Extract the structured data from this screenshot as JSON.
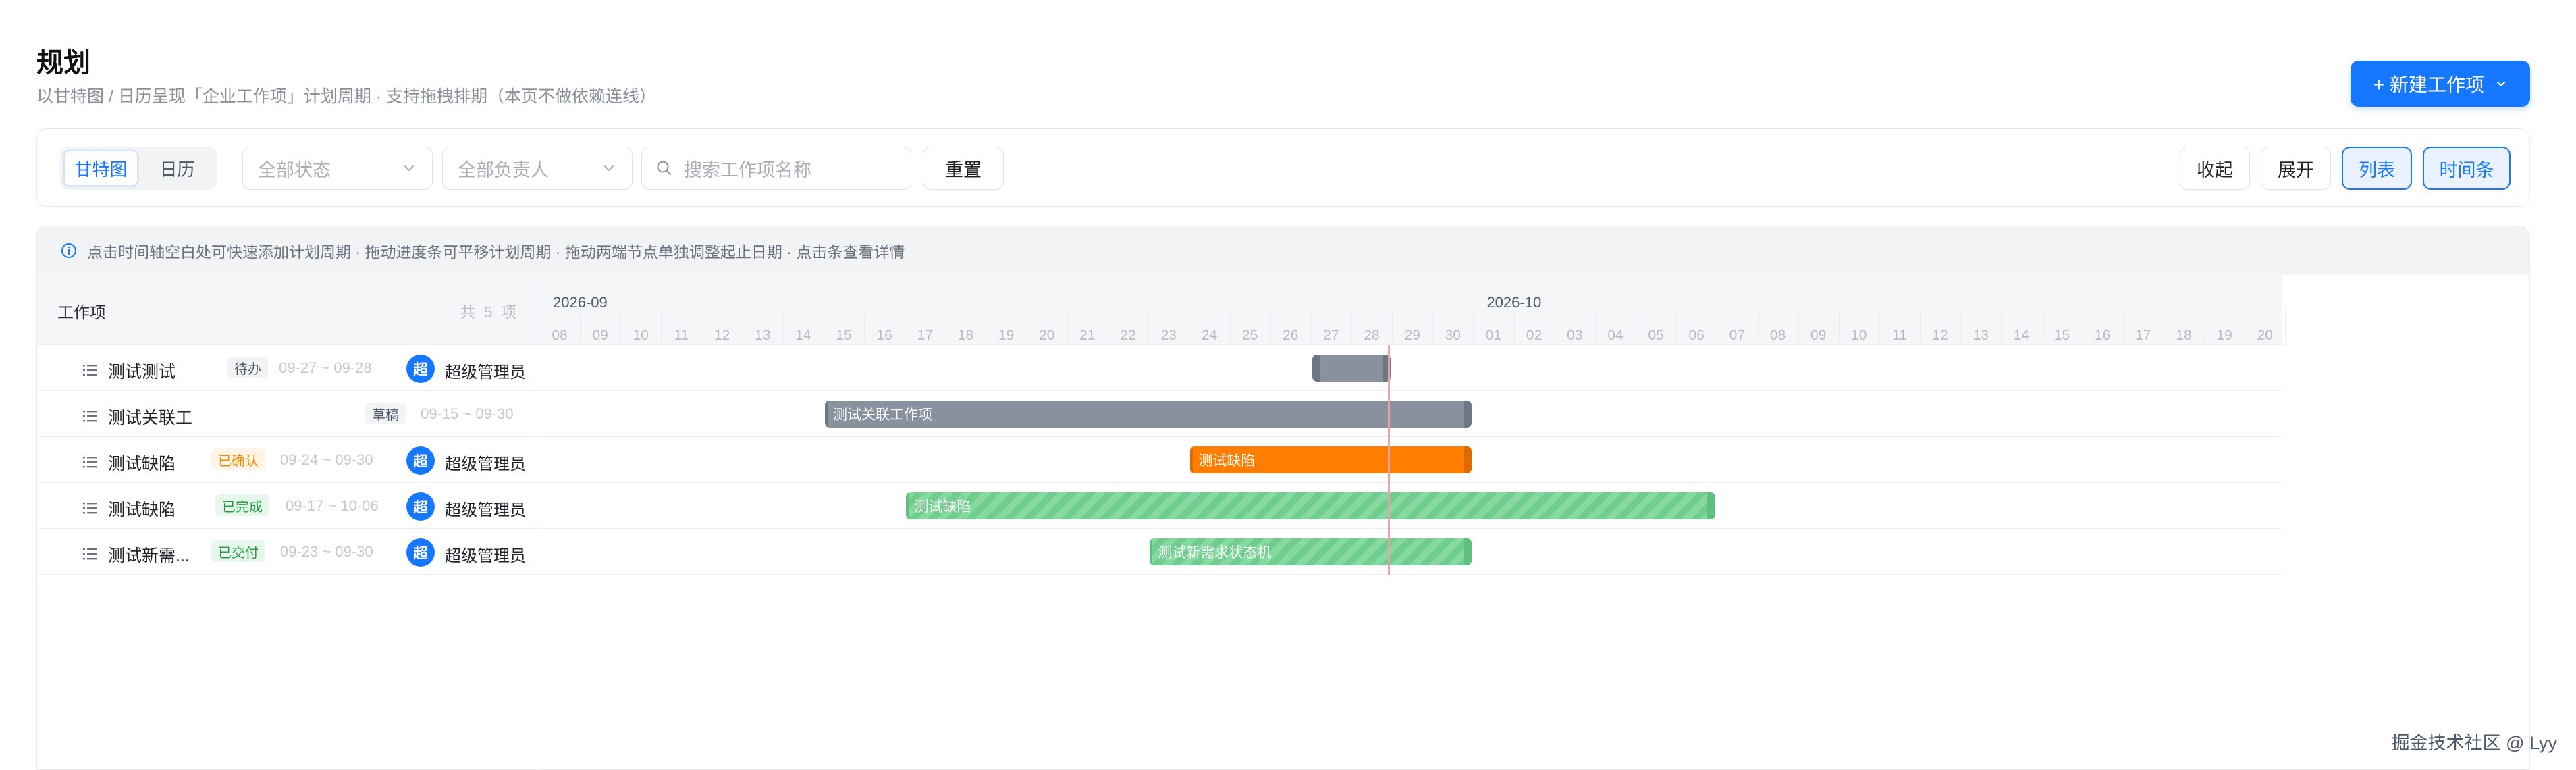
{
  "header": {
    "title": "规划",
    "subtitle": "以甘特图 / 日历呈现「企业工作项」计划周期 · 支持拖拽排期（本页不做依赖连线）",
    "new_button": "+ 新建工作项"
  },
  "toolbar": {
    "views": [
      "甘特图",
      "日历"
    ],
    "active_view": "甘特图",
    "status_filter": "全部状态",
    "owner_filter": "全部负责人",
    "search_placeholder": "搜索工作项名称",
    "reset": "重置",
    "collapse": "收起",
    "expand": "展开",
    "list": "列表",
    "timeline": "时间条"
  },
  "gantt": {
    "hint": "点击时间轴空白处可快速添加计划周期 · 拖动进度条可平移计划周期 · 拖动两端节点单独调整起止日期 · 点击条查看详情",
    "left_header": "工作项",
    "count": "共 5 项",
    "months": [
      "2026-09",
      "2026-10"
    ],
    "days": [
      "08",
      "09",
      "10",
      "11",
      "12",
      "13",
      "14",
      "15",
      "16",
      "17",
      "18",
      "19",
      "20",
      "21",
      "22",
      "23",
      "24",
      "25",
      "26",
      "27",
      "28",
      "29",
      "30",
      "01",
      "02",
      "03",
      "04",
      "05",
      "06",
      "07",
      "08",
      "09",
      "10",
      "11",
      "12",
      "13",
      "14",
      "15",
      "16",
      "17",
      "18",
      "19",
      "20"
    ],
    "today": "2026-09-28",
    "rows": [
      {
        "name": "测试测试",
        "status": "待办",
        "status_color": "#f2f3f5",
        "status_text_color": "#4e5969",
        "dates": "09-27 ~ 09-28",
        "avatar": "超",
        "owner": "超级管理员",
        "bar_start": "2026-09-27",
        "bar_end": "2026-09-28",
        "bar_label": "",
        "bar_color": "#8a919e"
      },
      {
        "name": "测试关联工作项",
        "status": "草稿",
        "status_color": "#f2f3f5",
        "status_text_color": "#4e5969",
        "dates": "09-15 ~ 09-30",
        "avatar": "",
        "owner": "",
        "bar_start": "2026-09-15",
        "bar_end": "2026-09-30",
        "bar_label": "测试关联工作项",
        "bar_color": "#8a919e"
      },
      {
        "name": "测试缺陷",
        "status": "已确认",
        "status_color": "#fff4e5",
        "status_text_color": "#f08c00",
        "dates": "09-24 ~ 09-30",
        "avatar": "超",
        "owner": "超级管理员",
        "bar_start": "2026-09-24",
        "bar_end": "2026-09-30",
        "bar_label": "测试缺陷",
        "bar_color": "#ff7d00"
      },
      {
        "name": "测试缺陷",
        "status": "已完成",
        "status_color": "#e8f7ec",
        "status_text_color": "#23a148",
        "dates": "09-17 ~ 10-06",
        "avatar": "超",
        "owner": "超级管理员",
        "bar_start": "2026-09-17",
        "bar_end": "2026-10-06",
        "bar_label": "测试缺陷",
        "bar_color": "#7fd69a"
      },
      {
        "name": "测试新需...",
        "status": "已交付",
        "status_color": "#e8f7ec",
        "status_text_color": "#23a148",
        "dates": "09-23 ~ 09-30",
        "avatar": "超",
        "owner": "超级管理员",
        "bar_start": "2026-09-23",
        "bar_end": "2026-09-30",
        "bar_label": "测试新需求状态机",
        "bar_color": "#7fd69a"
      }
    ]
  },
  "footer": {
    "watermark": "掘金技术社区 @ Lyy"
  }
}
